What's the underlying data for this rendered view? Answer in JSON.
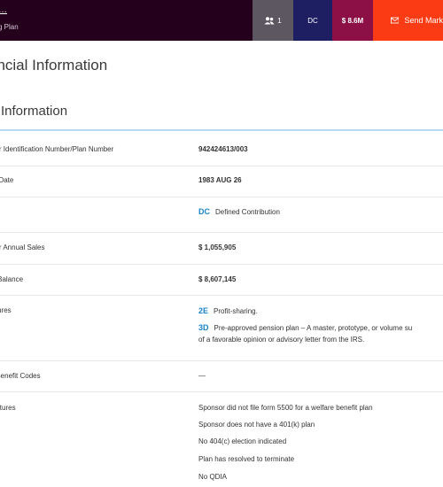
{
  "header": {
    "brand_top": "…",
    "brand_sub": "g Plan",
    "participants": "1",
    "plan_type_badge": "DC",
    "assets_badge": "$ 8.6M",
    "send_label": "Send Mark"
  },
  "page": {
    "title": "ancial Information"
  },
  "section": {
    "title": "ic Information"
  },
  "rows": {
    "ein": {
      "label": "oyer Identification Number/Plan Number",
      "value": "942424613/003"
    },
    "date": {
      "label": "ive Date",
      "value": "1983 AUG 26"
    },
    "type": {
      "label": "ype",
      "code": "DC",
      "desc": "Defined Contribution"
    },
    "sales": {
      "label": "oyer Annual Sales",
      "value": "$ 1,055,905"
    },
    "balance": {
      "label": "ge Balance",
      "value": "$ 8,607,145"
    },
    "features": {
      "label": "eatures",
      "items": [
        {
          "code": "2E",
          "desc": "Profit-sharing."
        },
        {
          "code": "3D",
          "desc": "Pre-approved pension plan – A master, prototype, or volume su",
          "desc2": "of a favorable opinion or advisory letter from the IRS."
        }
      ]
    },
    "welfare": {
      "label": "re Benefit Codes",
      "value": "—"
    },
    "other": {
      "label": "Features",
      "items": [
        "Sponsor did not file form 5500 for a welfare benefit plan",
        "Sponsor does not have a 401(k) plan",
        "No 404(c) election indicated",
        "Plan has resolved to terminate",
        "No QDIA"
      ]
    }
  }
}
